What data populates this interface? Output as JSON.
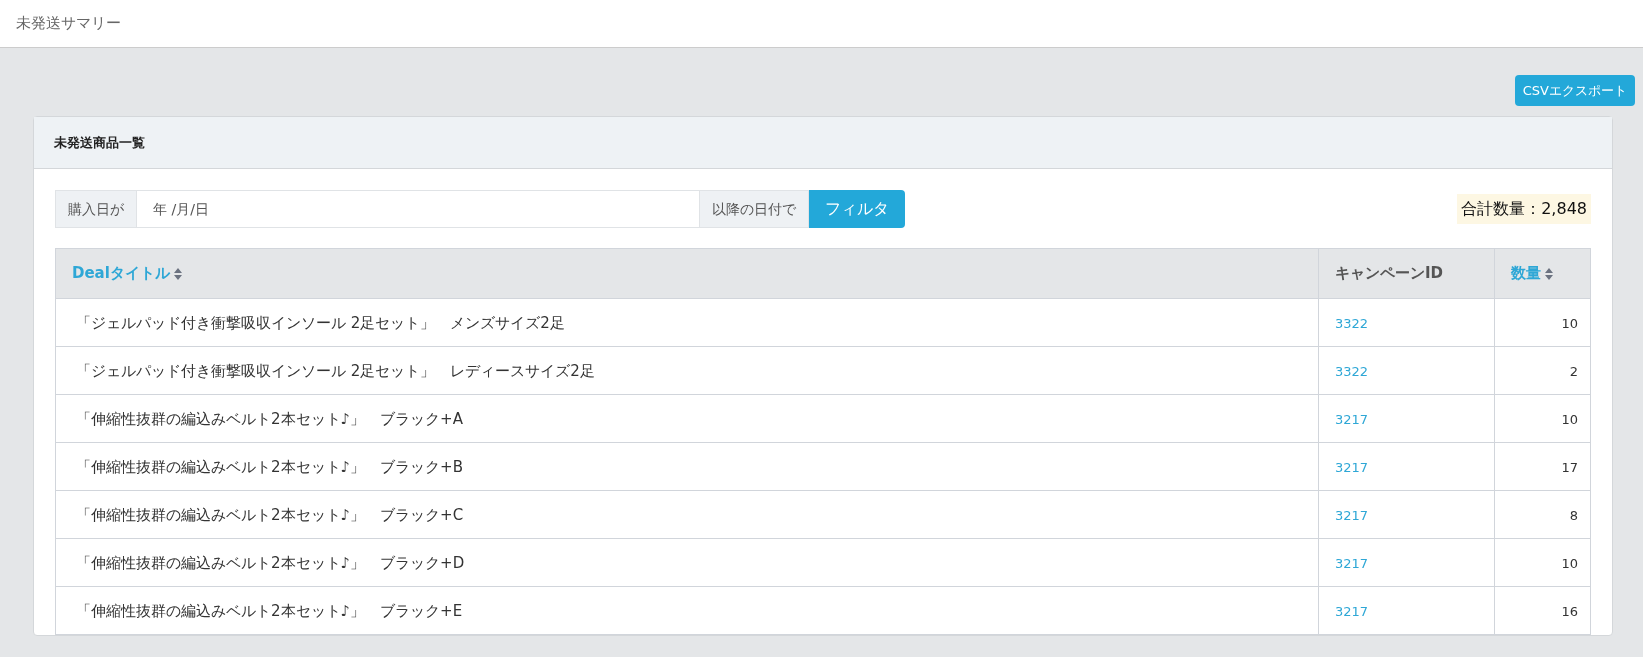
{
  "page_title": "未発送サマリー",
  "export_button": "CSVエクスポート",
  "card": {
    "title": "未発送商品一覧",
    "filter": {
      "prefix": "購入日が",
      "date_placeholder": "年 /月/日",
      "suffix": "以降の日付で",
      "button": "フィルタ"
    },
    "total": "合計数量：2,848",
    "table": {
      "columns": [
        {
          "label": "Dealタイトル",
          "sortable": true
        },
        {
          "label": "キャンペーンID",
          "sortable": false
        },
        {
          "label": "数量",
          "sortable": true
        }
      ],
      "rows": [
        {
          "title": "「ジェルパッド付き衝撃吸収インソール 2足セット」　メンズサイズ2足",
          "campaign_id": "3322",
          "quantity": "10"
        },
        {
          "title": "「ジェルパッド付き衝撃吸収インソール 2足セット」　レディースサイズ2足",
          "campaign_id": "3322",
          "quantity": "2"
        },
        {
          "title": "「伸縮性抜群の編込みベルト2本セット♪」　ブラック+A",
          "campaign_id": "3217",
          "quantity": "10"
        },
        {
          "title": "「伸縮性抜群の編込みベルト2本セット♪」　ブラック+B",
          "campaign_id": "3217",
          "quantity": "17"
        },
        {
          "title": "「伸縮性抜群の編込みベルト2本セット♪」　ブラック+C",
          "campaign_id": "3217",
          "quantity": "8"
        },
        {
          "title": "「伸縮性抜群の編込みベルト2本セット♪」　ブラック+D",
          "campaign_id": "3217",
          "quantity": "10"
        },
        {
          "title": "「伸縮性抜群の編込みベルト2本セット♪」　ブラック+E",
          "campaign_id": "3217",
          "quantity": "16"
        }
      ]
    }
  }
}
